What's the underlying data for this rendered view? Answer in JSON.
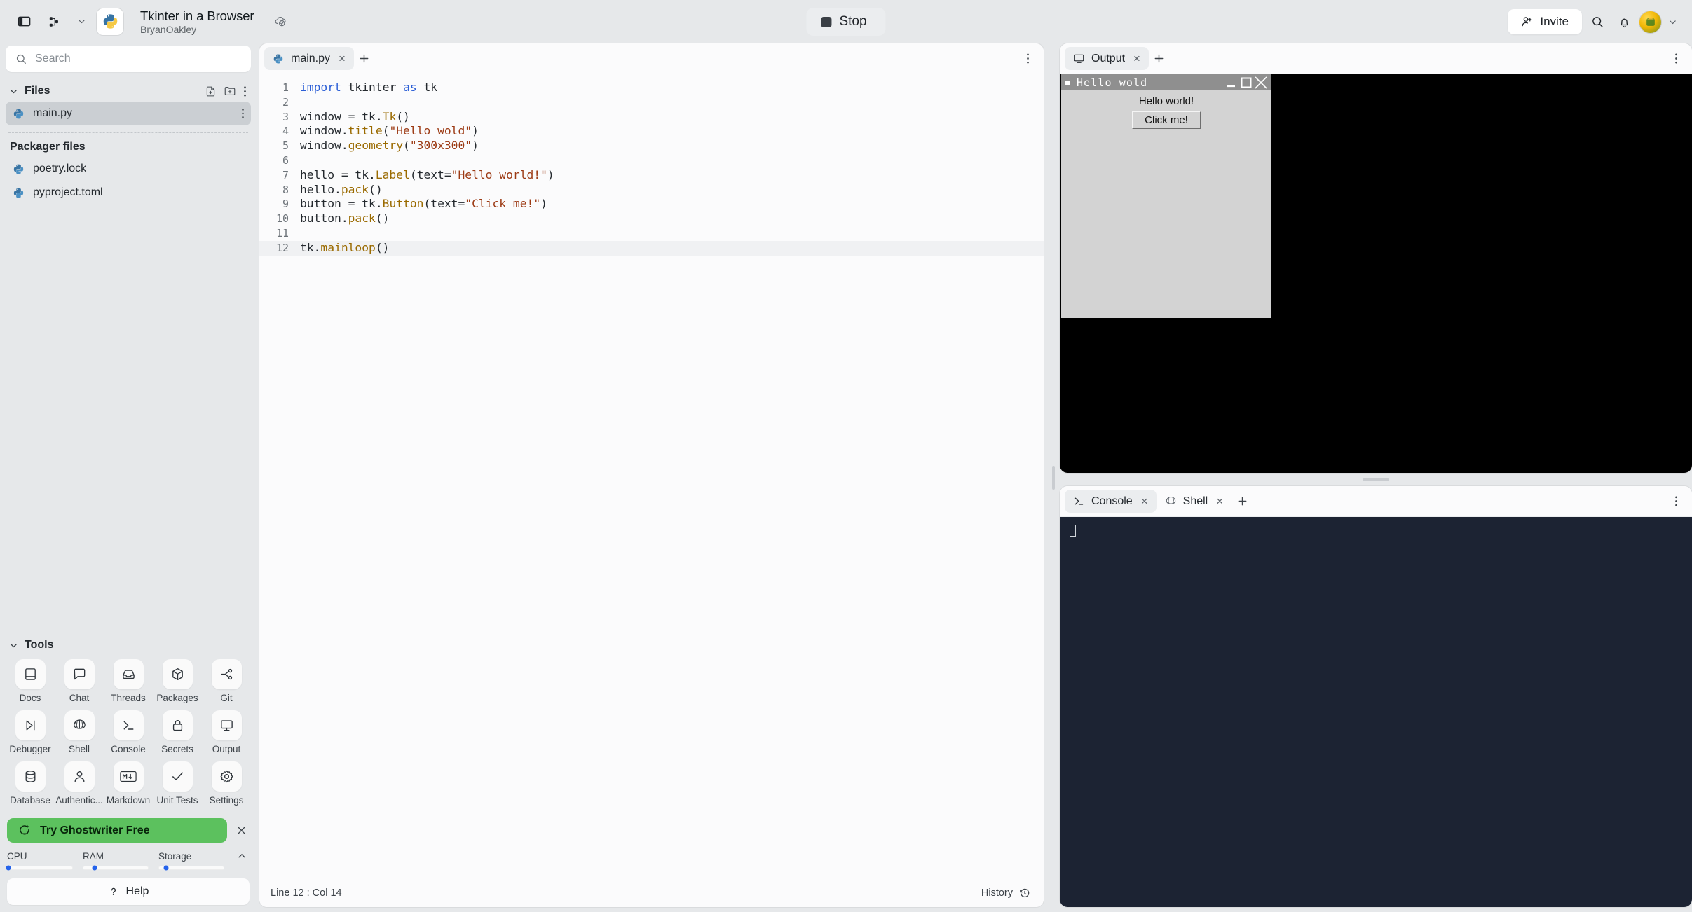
{
  "topbar": {
    "sidebar_toggle_icon": "sidebar-panel-icon",
    "git_branch_icon": "git-branch-icon",
    "chevron_icon": "chevron-down-icon",
    "project_title": "Tkinter in a Browser",
    "project_owner": "BryanOakley",
    "project_badge_icon": "cloud-check-icon",
    "stop_label": "Stop",
    "stop_icon": "stop-square-icon",
    "invite_label": "Invite",
    "invite_icon": "person-plus-icon",
    "search_icon": "search-icon",
    "bell_icon": "bell-icon",
    "avatar_icon": "avatar",
    "avatar_chevron_icon": "chevron-down-icon"
  },
  "sidebar": {
    "search": {
      "placeholder": "Search",
      "value": "",
      "icon": "search-icon"
    },
    "files_section": {
      "title": "Files",
      "caret_icon": "chevron-down-icon",
      "new_file_icon": "new-file-icon",
      "new_folder_icon": "new-folder-icon",
      "more_icon": "more-vertical-icon",
      "items": [
        {
          "name": "main.py",
          "icon": "python-file-icon",
          "selected": true,
          "more_icon": "more-vertical-icon"
        }
      ]
    },
    "packager_section": {
      "title": "Packager files",
      "items": [
        {
          "name": "poetry.lock",
          "icon": "python-file-icon"
        },
        {
          "name": "pyproject.toml",
          "icon": "python-file-icon"
        }
      ]
    },
    "tools": {
      "title": "Tools",
      "caret_icon": "chevron-down-icon",
      "items": [
        {
          "label": "Docs",
          "icon": "book-icon"
        },
        {
          "label": "Chat",
          "icon": "chat-bubble-icon"
        },
        {
          "label": "Threads",
          "icon": "inbox-icon"
        },
        {
          "label": "Packages",
          "icon": "cube-icon"
        },
        {
          "label": "Git",
          "icon": "git-branch-icon"
        },
        {
          "label": "Debugger",
          "icon": "step-over-icon"
        },
        {
          "label": "Shell",
          "icon": "shell-icon"
        },
        {
          "label": "Console",
          "icon": "terminal-prompt-icon"
        },
        {
          "label": "Secrets",
          "icon": "lock-icon"
        },
        {
          "label": "Output",
          "icon": "monitor-icon"
        },
        {
          "label": "Database",
          "icon": "database-icon"
        },
        {
          "label": "Authentic...",
          "icon": "person-icon"
        },
        {
          "label": "Markdown",
          "icon": "markdown-icon"
        },
        {
          "label": "Unit Tests",
          "icon": "check-icon"
        },
        {
          "label": "Settings",
          "icon": "gear-icon"
        }
      ]
    },
    "promo": {
      "label": "Try Ghostwriter Free",
      "icon": "ghostwriter-icon",
      "close_icon": "close-icon",
      "color": "#5cc15e"
    },
    "meters": {
      "collapse_icon": "chevron-up-icon",
      "items": [
        {
          "label": "CPU",
          "percent": 2
        },
        {
          "label": "RAM",
          "percent": 18
        },
        {
          "label": "Storage",
          "percent": 12
        }
      ],
      "dot_color": "#2563eb"
    },
    "help": {
      "label": "Help",
      "icon": "question-mark-icon"
    }
  },
  "editor": {
    "tabs": [
      {
        "label": "main.py",
        "icon": "python-file-icon",
        "active": true,
        "close_icon": "close-icon"
      }
    ],
    "add_tab_icon": "plus-icon",
    "more_icon": "more-vertical-icon",
    "lines": [
      {
        "n": "1",
        "tokens": [
          {
            "t": "import",
            "c": "kw"
          },
          {
            "t": " tkinter ",
            "c": "ct"
          },
          {
            "t": "as",
            "c": "kw"
          },
          {
            "t": " tk",
            "c": "ct"
          }
        ]
      },
      {
        "n": "2",
        "tokens": []
      },
      {
        "n": "3",
        "tokens": [
          {
            "t": "window = tk.",
            "c": "ct"
          },
          {
            "t": "Tk",
            "c": "fn"
          },
          {
            "t": "()",
            "c": "ct"
          }
        ]
      },
      {
        "n": "4",
        "tokens": [
          {
            "t": "window.",
            "c": "ct"
          },
          {
            "t": "title",
            "c": "fn"
          },
          {
            "t": "(",
            "c": "ct"
          },
          {
            "t": "\"Hello wold\"",
            "c": "st"
          },
          {
            "t": ")",
            "c": "ct"
          }
        ]
      },
      {
        "n": "5",
        "tokens": [
          {
            "t": "window.",
            "c": "ct"
          },
          {
            "t": "geometry",
            "c": "fn"
          },
          {
            "t": "(",
            "c": "ct"
          },
          {
            "t": "\"300x300\"",
            "c": "st"
          },
          {
            "t": ")",
            "c": "ct"
          }
        ]
      },
      {
        "n": "6",
        "tokens": []
      },
      {
        "n": "7",
        "tokens": [
          {
            "t": "hello = tk.",
            "c": "ct"
          },
          {
            "t": "Label",
            "c": "fn"
          },
          {
            "t": "(text=",
            "c": "ct"
          },
          {
            "t": "\"Hello world!\"",
            "c": "st"
          },
          {
            "t": ")",
            "c": "ct"
          }
        ]
      },
      {
        "n": "8",
        "tokens": [
          {
            "t": "hello.",
            "c": "ct"
          },
          {
            "t": "pack",
            "c": "fn"
          },
          {
            "t": "()",
            "c": "ct"
          }
        ]
      },
      {
        "n": "9",
        "tokens": [
          {
            "t": "button = tk.",
            "c": "ct"
          },
          {
            "t": "Button",
            "c": "fn"
          },
          {
            "t": "(text=",
            "c": "ct"
          },
          {
            "t": "\"Click me!\"",
            "c": "st"
          },
          {
            "t": ")",
            "c": "ct"
          }
        ]
      },
      {
        "n": "10",
        "tokens": [
          {
            "t": "button.",
            "c": "ct"
          },
          {
            "t": "pack",
            "c": "fn"
          },
          {
            "t": "()",
            "c": "ct"
          }
        ]
      },
      {
        "n": "11",
        "tokens": []
      },
      {
        "n": "12",
        "tokens": [
          {
            "t": "tk.",
            "c": "ct"
          },
          {
            "t": "mainloop",
            "c": "fn"
          },
          {
            "t": "()",
            "c": "ct"
          }
        ],
        "highlight": true
      }
    ],
    "status": {
      "position": "Line 12 : Col 14",
      "history_label": "History",
      "history_icon": "history-clock-icon"
    }
  },
  "output_panel": {
    "tabs": [
      {
        "label": "Output",
        "icon": "monitor-icon",
        "active": true,
        "close_icon": "close-icon"
      }
    ],
    "add_tab_icon": "plus-icon",
    "more_icon": "more-vertical-icon",
    "tk_window": {
      "title": "Hello wold",
      "title_dot_icon": "window-menu-icon",
      "minimize_icon": "minimize-icon",
      "maximize_icon": "maximize-icon",
      "close_icon": "close-icon",
      "label_text": "Hello world!",
      "button_text": "Click me!"
    },
    "cursor_icon": "mouse-pointer-icon"
  },
  "console_panel": {
    "tabs": [
      {
        "label": "Console",
        "icon": "terminal-prompt-icon",
        "active": true,
        "close_icon": "close-icon"
      },
      {
        "label": "Shell",
        "icon": "shell-icon",
        "active": false,
        "close_icon": "close-icon"
      }
    ],
    "add_tab_icon": "plus-icon",
    "more_icon": "more-vertical-icon",
    "content": ""
  }
}
